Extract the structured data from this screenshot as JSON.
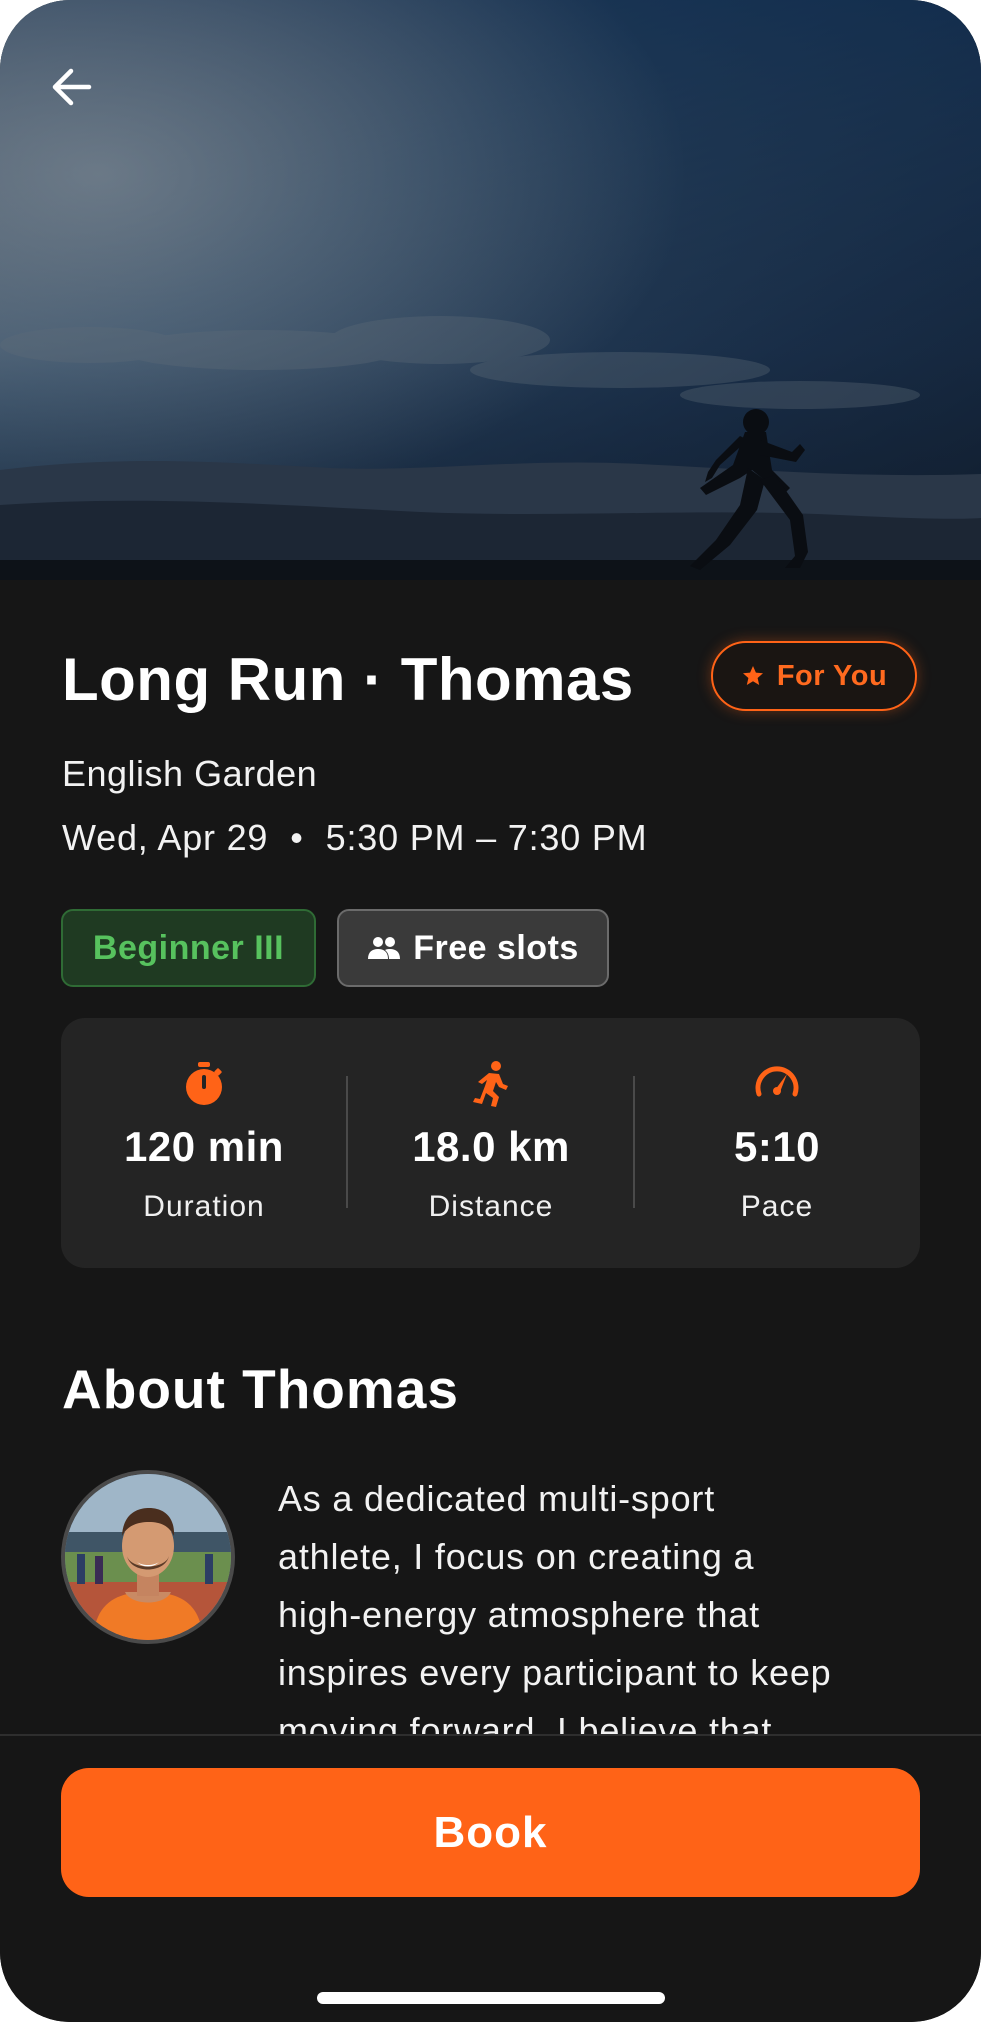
{
  "hero": {
    "image_description": "runner silhouette at dusk",
    "back_icon": "arrow-left-icon"
  },
  "event": {
    "title": "Long Run · Thomas",
    "location": "English Garden",
    "date": "Wed, Apr 29",
    "separator": "•",
    "time": "5:30 PM – 7:30 PM",
    "recommendation_badge": {
      "icon": "star-icon",
      "label": "For You"
    },
    "level_badge": "Beginner III",
    "slots_badge": {
      "icon": "people-icon",
      "label": "Free slots"
    }
  },
  "stats": [
    {
      "icon": "stopwatch-icon",
      "value": "120 min",
      "label": "Duration"
    },
    {
      "icon": "running-person-icon",
      "value": "18.0 km",
      "label": "Distance"
    },
    {
      "icon": "speedometer-icon",
      "value": "5:10",
      "label": "Pace"
    }
  ],
  "about": {
    "title": "About Thomas",
    "bio_lines": [
      "As a dedicated multi-sport",
      "athlete, I focus on creating a",
      "high-energy atmosphere that",
      "inspires every participant to keep",
      "moving forward. I believe that"
    ]
  },
  "actions": {
    "book_label": "Book"
  },
  "colors": {
    "accent": "#ff6317",
    "background": "#161616",
    "card": "#242424",
    "level_green": "#57c25e"
  }
}
